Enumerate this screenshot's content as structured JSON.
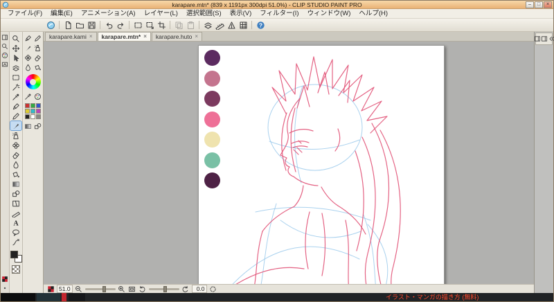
{
  "window": {
    "title_text": "karapare.mtn* (839 x 1191px 300dpi 51.0%) - CLIP STUDIO PAINT PRO",
    "minimize_label": "–",
    "maximize_label": "□",
    "close_label": "×"
  },
  "menubar": {
    "items": [
      "ファイル(F)",
      "編集(E)",
      "アニメーション(A)",
      "レイヤー(L)",
      "選択範囲(S)",
      "表示(V)",
      "フィルター(I)",
      "ウィンドウ(W)",
      "ヘルプ(H)"
    ]
  },
  "toolbar": {
    "groups": [
      [
        "clip-studio-logo"
      ],
      [
        "new-file",
        "open-file",
        "save-file"
      ],
      [
        "undo",
        "redo"
      ],
      [
        "selection",
        "transform",
        "crop"
      ],
      [
        "copy",
        "paste"
      ],
      [
        "layer-move",
        "snap-ruler",
        "snap-special",
        "snap-grid"
      ],
      [
        "help"
      ]
    ],
    "disabled": [
      "copy",
      "paste"
    ]
  },
  "left_dock": {
    "mini_strip": [
      "panel",
      "magnifier",
      "palette",
      "nav"
    ],
    "mini_strip_bottom": [
      "checker-red",
      "dot"
    ],
    "tools": [
      "magnifier",
      "move",
      "operation",
      "layer-move",
      "selection",
      "auto-select",
      "eyedropper",
      "pen",
      "pencil",
      "brush",
      "airbrush",
      "decoration",
      "eraser",
      "blend",
      "fill",
      "gradient",
      "figure",
      "frame",
      "ruler",
      "text",
      "balloon",
      "line-correct"
    ],
    "selected_tool": "brush",
    "subtool_rows": [
      [
        "pen",
        "pencil"
      ],
      [
        "brush",
        "airbrush"
      ],
      [
        "decoration",
        "eraser"
      ],
      [
        "blend",
        "fill"
      ]
    ],
    "subtool_rows2": [
      [
        "eyedropper",
        "palette"
      ],
      [
        "gradient",
        "figure"
      ]
    ],
    "palette_grid": [
      "#cc3333",
      "#33aa44",
      "#3355cc",
      "#ddcc33",
      "#33bbcc",
      "#bb44bb",
      "#222222",
      "#ffffff",
      "#888888"
    ],
    "main_color": "#222222",
    "sub_color": "#ffffff"
  },
  "tabs": {
    "close_glyph": "×",
    "items": [
      {
        "label": "karapare.kami",
        "active": false
      },
      {
        "label": "karapare.mtn*",
        "active": true
      },
      {
        "label": "karapare.huto",
        "active": false
      }
    ]
  },
  "canvas": {
    "swatches": [
      "#5c2b60",
      "#c4748e",
      "#7c3a5f",
      "#ee7097",
      "#efe3ae",
      "#79c0a5",
      "#4e2245"
    ],
    "stroke_main": "#e25578",
    "stroke_under": "#94c6ea"
  },
  "right_dock": {
    "header_icons": [
      "panel",
      "panel",
      "chevron-double-left"
    ]
  },
  "status_bar": {
    "zoom_value": "51.0",
    "rotation_value": "0.0"
  },
  "bottom_bar": {
    "notice_text": "イラスト・マンガの描き方 (無料)"
  }
}
